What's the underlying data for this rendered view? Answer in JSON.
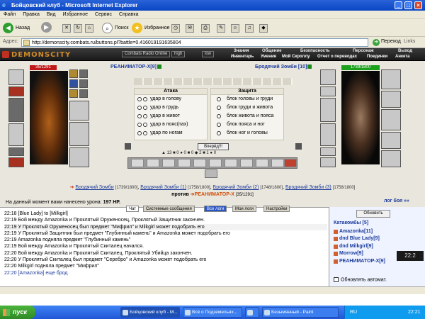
{
  "window": {
    "title": "Бойцовский клуб - Microsoft Internet Explorer"
  },
  "menu": [
    "Файл",
    "Правка",
    "Вид",
    "Избранное",
    "Сервис",
    "Справка"
  ],
  "toolbar": {
    "back": "Назад",
    "search": "Поиск",
    "favorites": "Избранное"
  },
  "address": {
    "label": "Адрес:",
    "url": "http://demonscity.combats.ru/buttons.pl?battle=0.416019191635804",
    "go": "Переход",
    "links": "Links"
  },
  "game": {
    "logo": "DEMONSCITY",
    "radio": "Combats Radio Online",
    "high": "high",
    "low": "low",
    "nav_top": [
      "Знания",
      "Общение",
      "Безопасность",
      "Персонаж",
      "Выход"
    ],
    "nav_bottom": [
      "Инвентарь",
      "Умения",
      "Мой Скроллу",
      "Отчет о переводах",
      "Поединки",
      "Анкета"
    ]
  },
  "player": {
    "name": "РЕАНИМАТОР-Х",
    "level": "[9]",
    "hp": "35/1291"
  },
  "enemy": {
    "name": "Бродячий Зомби",
    "level": "[10]",
    "hp": "1739/1800"
  },
  "attack": {
    "title": "Атака",
    "options": [
      "удар в голову",
      "удар в грудь",
      "удар в живот",
      "удар в пояс(пах)",
      "удар по ногам"
    ]
  },
  "defend": {
    "title": "Защита",
    "options": [
      "блок головы и груди",
      "блок груди и живота",
      "блок живота и пояса",
      "блок пояса и ног",
      "блок ног и головы"
    ]
  },
  "go_button": "Вперёд!!!",
  "counters": "▲ 13   ■ 0   ● 0   ■ 0   ◆ 2   ■ 1   ● 0",
  "teams": [
    {
      "name": "Бродячий Зомби",
      "hp": "[1739/1800]"
    },
    {
      "name": "Бродячий Зомби (1)",
      "hp": "[1758/1800]"
    },
    {
      "name": "Бродячий Зомби (2)",
      "hp": "[1748/1800]"
    },
    {
      "name": "Бродячий Зомби (3)",
      "hp": "[1758/1800]"
    }
  ],
  "versus": {
    "word": "против",
    "me": "РЕАНИМАТОР-Х",
    "hp": "[35/1291]"
  },
  "damage": {
    "text": "На данный момент вами нанесено урона:",
    "value": "197 HP."
  },
  "log_link": "лог боя »»",
  "chat_tabs": [
    "Чат",
    "Системные сообщения",
    "Все логи",
    "Мои логи",
    "Настройки"
  ],
  "chat": [
    "22:18 [Blue Lady] to [Milkgirl]",
    "22:19 Бой между Amazonka и Проклятый Оруженосец, Проклятый Защитник закончен.",
    "22:19 У Проклятый Оруженосец был предмет \"Мифрил\" и Milkgirl может подобрать его",
    "22:19 У Проклятый Защитник был предмет \"Глубинный камень\" и Amazonka может подобрать его",
    "22:19 Amazonka подняла предмет \"Глубинный камень\"",
    "22:19 Бой между Amazonka и Проклятый Скиталец начался.",
    "22:20 Бой между Amazonka и Проклятый Скиталец, Проклятый Убийца закончен.",
    "22:20 У Проклятый Скиталец был предмет \"Серебро\" и Amazonka может подобрать его",
    "22:20 Milkgirl подняла предмет \"Мифрил\"",
    "22:20 [Amazonka] еще брод"
  ],
  "right": {
    "refresh": "Обновить",
    "location": "Катакомбы [5]",
    "users": [
      "Amazonka[11]",
      "dnd Blue Lady[9]",
      "dnd Milkgirl[9]",
      "Morrow[9]",
      "РЕАНИМАТОР-Х[9]"
    ],
    "auto": "Обновлять автомат."
  },
  "clock": "22:2",
  "taskbar": {
    "start": "пуск",
    "buttons": [
      "Бойцовский клуб - M...",
      "Всё о Подземельях...",
      "",
      "Безымянный - Paint"
    ],
    "lang": "RU",
    "time": "22:21"
  }
}
